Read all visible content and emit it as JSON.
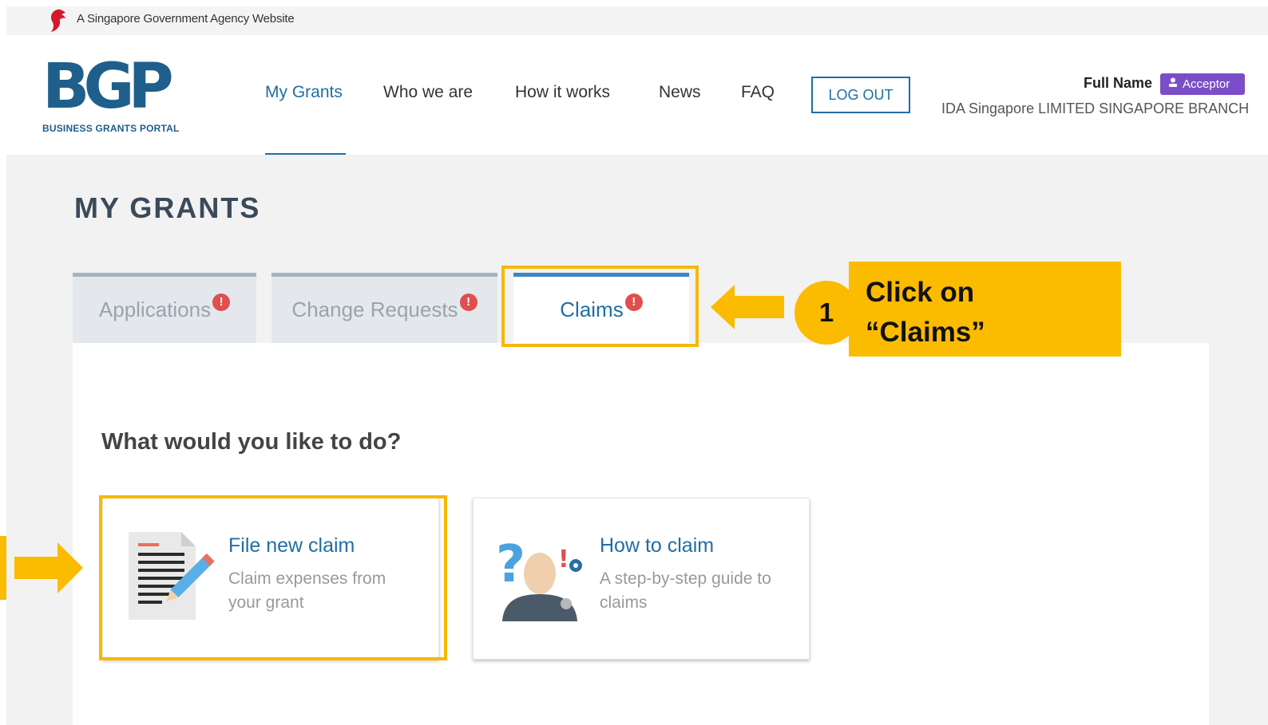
{
  "gov_bar": {
    "text": "A Singapore Government Agency Website"
  },
  "logo": {
    "main": "BGP",
    "sub": "BUSINESS GRANTS PORTAL"
  },
  "nav": [
    {
      "label": "My Grants",
      "active": true
    },
    {
      "label": "Who we are"
    },
    {
      "label": "How it works"
    },
    {
      "label": "News"
    },
    {
      "label": "FAQ"
    }
  ],
  "header": {
    "logout_label": "LOG OUT",
    "user_name": "Full Name",
    "role": "Acceptor",
    "company": "IDA Singapore LIMITED SINGAPORE BRANCH"
  },
  "page": {
    "title": "MY GRANTS"
  },
  "tabs": [
    {
      "label": "Applications",
      "alert": "!"
    },
    {
      "label": "Change Requests",
      "alert": "!"
    },
    {
      "label": "Claims",
      "alert": "!",
      "active": true
    }
  ],
  "content": {
    "question": "What would you like to do?",
    "cards": [
      {
        "title": "File new claim",
        "desc_line1": "Claim expenses from",
        "desc_line2": "your grant"
      },
      {
        "title": "How to claim",
        "desc_line1": "A step-by-step guide to",
        "desc_line2": "claims"
      }
    ]
  },
  "annotation": {
    "step": "1",
    "line1": "Click on",
    "line2": "“Claims”"
  },
  "colors": {
    "brand_blue": "#1f6ea5",
    "highlight_yellow": "#fbbb00",
    "role_badge": "#7b4ec7",
    "alert_red": "#e04e4e"
  }
}
